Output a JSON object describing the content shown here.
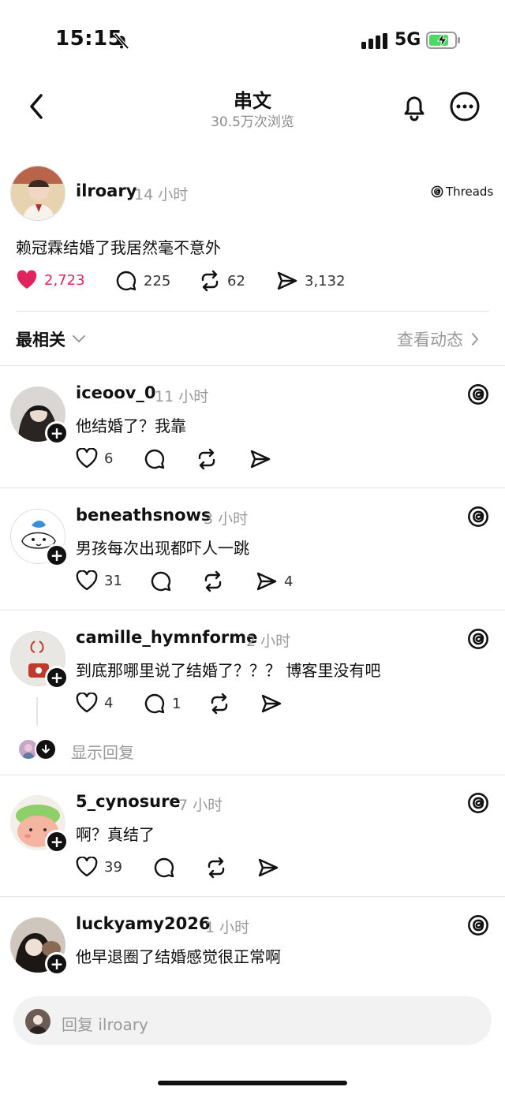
{
  "status_bar": {
    "time": "15:15",
    "network": "5G"
  },
  "header": {
    "title": "串文",
    "subtitle": "30.5万次浏览"
  },
  "post": {
    "username": "ilroary",
    "time": "14 小时",
    "source": "Threads",
    "text": "赖冠霖结婚了我居然毫不意外",
    "likes": "2,723",
    "comments": "225",
    "reposts": "62",
    "shares": "3,132"
  },
  "sort": {
    "label": "最相关",
    "activity_link": "查看动态"
  },
  "comments": [
    {
      "username": "iceoov_0",
      "time": "11 小时",
      "text": "他结婚了？我靠",
      "likes": "6",
      "replies": "",
      "reposts": "",
      "shares": ""
    },
    {
      "username": "beneathsnows",
      "time": "3 小时",
      "text": "男孩每次出现都吓人一跳",
      "likes": "31",
      "replies": "",
      "reposts": "",
      "shares": "4"
    },
    {
      "username": "camille_hymnforme",
      "time": "2 小时",
      "text": "到底那哪里说了结婚了？？？ 博客里没有吧",
      "likes": "4",
      "replies": "1",
      "reposts": "",
      "shares": ""
    },
    {
      "username": "5_cynosure",
      "time": "7 小时",
      "text": "啊？真结了",
      "likes": "39",
      "replies": "",
      "reposts": "",
      "shares": ""
    },
    {
      "username": "luckyamy2026",
      "time": "1 小时",
      "text": "他早退圈了结婚感觉很正常啊",
      "likes": "",
      "replies": "",
      "reposts": "",
      "shares": ""
    }
  ],
  "show_replies_label": "显示回复",
  "reply_bar": {
    "placeholder": "回复 ilroary"
  },
  "colors": {
    "like_active": "#e0245e",
    "muted_text": "#9a9a9a",
    "divider": "#e6e6e6"
  },
  "icons": [
    "bell-off-icon",
    "signal-icon",
    "battery-charging-icon",
    "back-chevron-icon",
    "bell-icon",
    "more-icon",
    "threads-logo-icon",
    "heart-icon",
    "comment-icon",
    "repost-icon",
    "share-icon",
    "chevron-down-icon",
    "chevron-right-icon",
    "plus-icon",
    "down-arrow-icon"
  ]
}
